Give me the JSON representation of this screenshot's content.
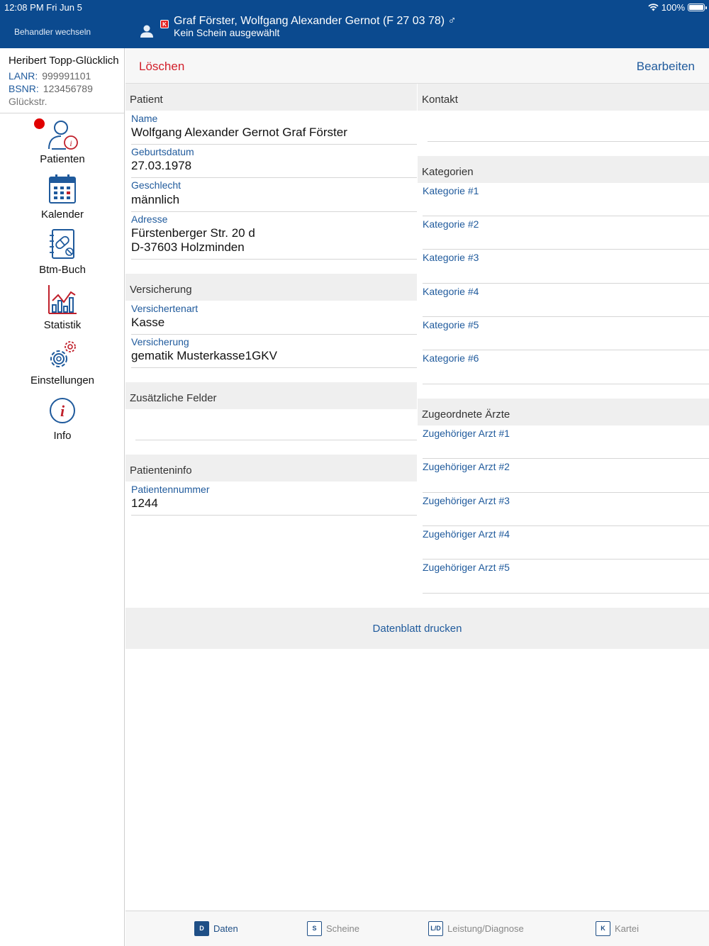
{
  "status": {
    "time": "12:08 PM  Fri Jun 5",
    "battery": "100%"
  },
  "header": {
    "switch_label": "Behandler wechseln",
    "badge": "K",
    "patient_title": "Graf Förster, Wolfgang Alexander Gernot  (F 27 03 78) ♂",
    "patient_sub": "Kein Schein ausgewählt"
  },
  "sidebar": {
    "doctor_name": "Heribert Topp-Glücklich",
    "lanr_label": "LANR:",
    "lanr_value": "999991101",
    "bsnr_label": "BSNR:",
    "bsnr_value": "123456789",
    "street": "Glückstr.",
    "nav": [
      "Patienten",
      "Kalender",
      "Btm-Buch",
      "Statistik",
      "Einstellungen",
      "Info"
    ]
  },
  "actions": {
    "delete": "Löschen",
    "edit": "Bearbeiten"
  },
  "patient": {
    "header": "Patient",
    "name_label": "Name",
    "name": "Wolfgang Alexander Gernot Graf Förster",
    "birth_label": "Geburtsdatum",
    "birth": "27.03.1978",
    "sex_label": "Geschlecht",
    "sex": "männlich",
    "address_label": "Adresse",
    "address_line1": "Fürstenberger Str. 20 d",
    "address_line2": "D-37603 Holzminden"
  },
  "insurance": {
    "header": "Versicherung",
    "type_label": "Versichertenart",
    "type": "Kasse",
    "ins_label": "Versicherung",
    "ins": "gematik Musterkasse1GKV"
  },
  "extra": {
    "header": "Zusätzliche Felder"
  },
  "patinfo": {
    "header": "Patienteninfo",
    "number_label": "Patientennummer",
    "number": "1244"
  },
  "contact": {
    "header": "Kontakt"
  },
  "categories": {
    "header": "Kategorien",
    "items": [
      "Kategorie #1",
      "Kategorie #2",
      "Kategorie #3",
      "Kategorie #4",
      "Kategorie #5",
      "Kategorie #6"
    ]
  },
  "doctors": {
    "header": "Zugeordnete Ärzte",
    "items": [
      "Zugehöriger Arzt #1",
      "Zugehöriger Arzt #2",
      "Zugehöriger Arzt #3",
      "Zugehöriger Arzt #4",
      "Zugehöriger Arzt #5"
    ]
  },
  "print_label": "Datenblatt drucken",
  "tabs": [
    {
      "key": "D",
      "label": "Daten"
    },
    {
      "key": "S",
      "label": "Scheine"
    },
    {
      "key": "L/D",
      "label": "Leistung/Diagnose"
    },
    {
      "key": "K",
      "label": "Kartei"
    }
  ]
}
